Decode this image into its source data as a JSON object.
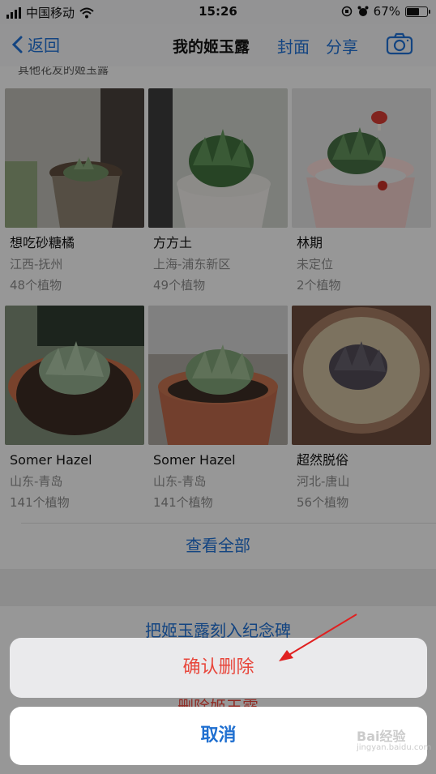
{
  "status": {
    "carrier": "中国移动",
    "time": "15:26",
    "battery": "67%",
    "battery_level": 0.67
  },
  "nav": {
    "back_label": "返回",
    "title": "我的姬玉露",
    "cover_label": "封面",
    "share_label": "分享"
  },
  "section_label": "其他花友的姬玉露",
  "users": [
    {
      "name": "想吃砂糖橘",
      "location": "江西-抚州",
      "count": "48个植物"
    },
    {
      "name": "方方土",
      "location": "上海-浦东新区",
      "count": "49个植物"
    },
    {
      "name": "林期",
      "location": "未定位",
      "count": "2个植物"
    },
    {
      "name": "Somer Hazel",
      "location": "山东-青岛",
      "count": "141个植物"
    },
    {
      "name": "Somer Hazel",
      "location": "山东-青岛",
      "count": "141个植物"
    },
    {
      "name": "超然脱俗",
      "location": "河北-唐山",
      "count": "56个植物"
    }
  ],
  "view_all": "查看全部",
  "memorial": "把姬玉露刻入纪念碑",
  "delete_plant": "删除姬玉露",
  "sheet": {
    "confirm": "确认删除",
    "cancel": "取消"
  },
  "watermark": {
    "brand": "Bai经验",
    "url": "jingyan.baidu.com"
  },
  "colors": {
    "accent": "#1f6fd0",
    "destructive": "#e8463b"
  }
}
